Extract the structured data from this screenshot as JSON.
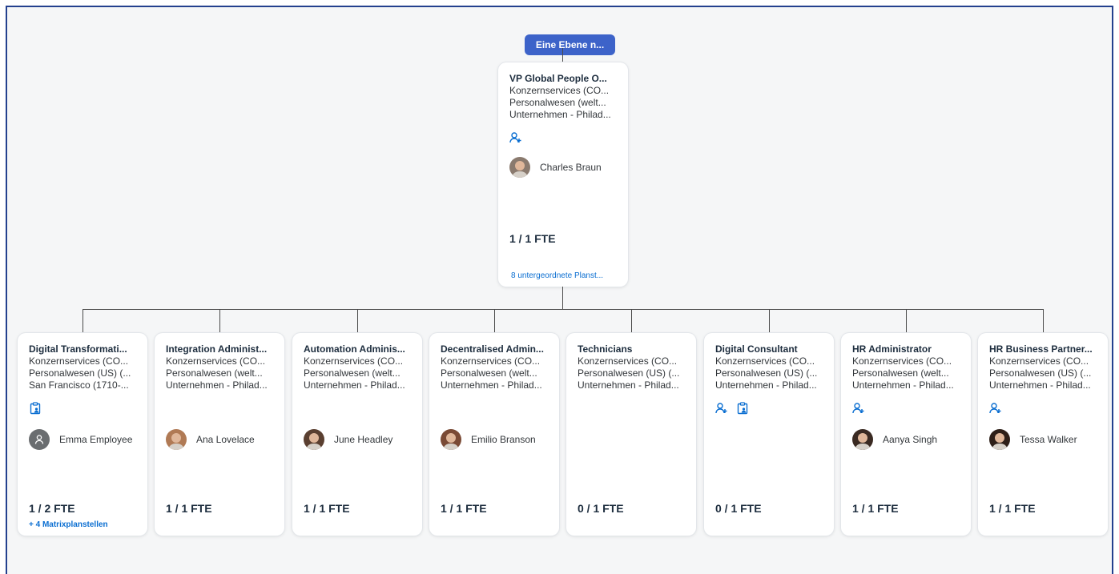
{
  "navigation": {
    "up_label": "Eine Ebene n..."
  },
  "root": {
    "title": "VP Global People O...",
    "lines": [
      "Konzernservices (CO...",
      "Personalwesen (welt...",
      "Unternehmen - Philad..."
    ],
    "icons": [
      "add-person-icon"
    ],
    "person": "Charles Braun",
    "avatar_color": "#8a7a6e",
    "fte": "1 / 1 FTE",
    "link": "8 untergeordnete Planst..."
  },
  "children": [
    {
      "title": "Digital Transformati...",
      "lines": [
        "Konzernservices (CO...",
        "Personalwesen (US) (...",
        "San Francisco (1710-..."
      ],
      "icons": [
        "clipboard-person-icon"
      ],
      "person": "Emma Employee",
      "avatar_type": "placeholder",
      "avatar_color": "#6a6d70",
      "fte": "1 / 2 FTE",
      "link": "+ 4 Matrixplanstellen"
    },
    {
      "title": "Integration Administ...",
      "lines": [
        "Konzernservices (CO...",
        "Personalwesen (welt...",
        "Unternehmen - Philad..."
      ],
      "icons": [],
      "person": "Ana Lovelace",
      "avatar_type": "photo",
      "avatar_color": "#b07a55",
      "fte": "1 / 1 FTE"
    },
    {
      "title": "Automation Adminis...",
      "lines": [
        "Konzernservices (CO...",
        "Personalwesen (welt...",
        "Unternehmen - Philad..."
      ],
      "icons": [],
      "person": "June Headley",
      "avatar_type": "photo",
      "avatar_color": "#5a3f30",
      "fte": "1 / 1 FTE"
    },
    {
      "title": "Decentralised Admin...",
      "lines": [
        "Konzernservices (CO...",
        "Personalwesen (welt...",
        "Unternehmen - Philad..."
      ],
      "icons": [],
      "person": "Emilio Branson",
      "avatar_type": "photo",
      "avatar_color": "#7a4a35",
      "fte": "1 / 1 FTE"
    },
    {
      "title": "Technicians",
      "lines": [
        "Konzernservices (CO...",
        "Personalwesen (US) (...",
        "Unternehmen - Philad..."
      ],
      "icons": [],
      "person": "",
      "fte": "0 / 1 FTE"
    },
    {
      "title": "Digital Consultant",
      "lines": [
        "Konzernservices (CO...",
        "Personalwesen (US) (...",
        "Unternehmen - Philad..."
      ],
      "icons": [
        "add-person-icon",
        "clipboard-person-icon"
      ],
      "person": "",
      "fte": "0 / 1 FTE"
    },
    {
      "title": "HR Administrator",
      "lines": [
        "Konzernservices (CO...",
        "Personalwesen (welt...",
        "Unternehmen - Philad..."
      ],
      "icons": [
        "add-person-icon"
      ],
      "person": "Aanya Singh",
      "avatar_type": "photo",
      "avatar_color": "#3a2a22",
      "fte": "1 / 1 FTE"
    },
    {
      "title": "HR Business Partner...",
      "lines": [
        "Konzernservices (CO...",
        "Personalwesen (US) (...",
        "Unternehmen - Philad..."
      ],
      "icons": [
        "add-person-icon"
      ],
      "person": "Tessa Walker",
      "avatar_type": "photo",
      "avatar_color": "#2e1f18",
      "fte": "1 / 1 FTE"
    }
  ],
  "colors": {
    "accent": "#0a6ed1",
    "button": "#3d63c9",
    "frame": "#23408e"
  }
}
